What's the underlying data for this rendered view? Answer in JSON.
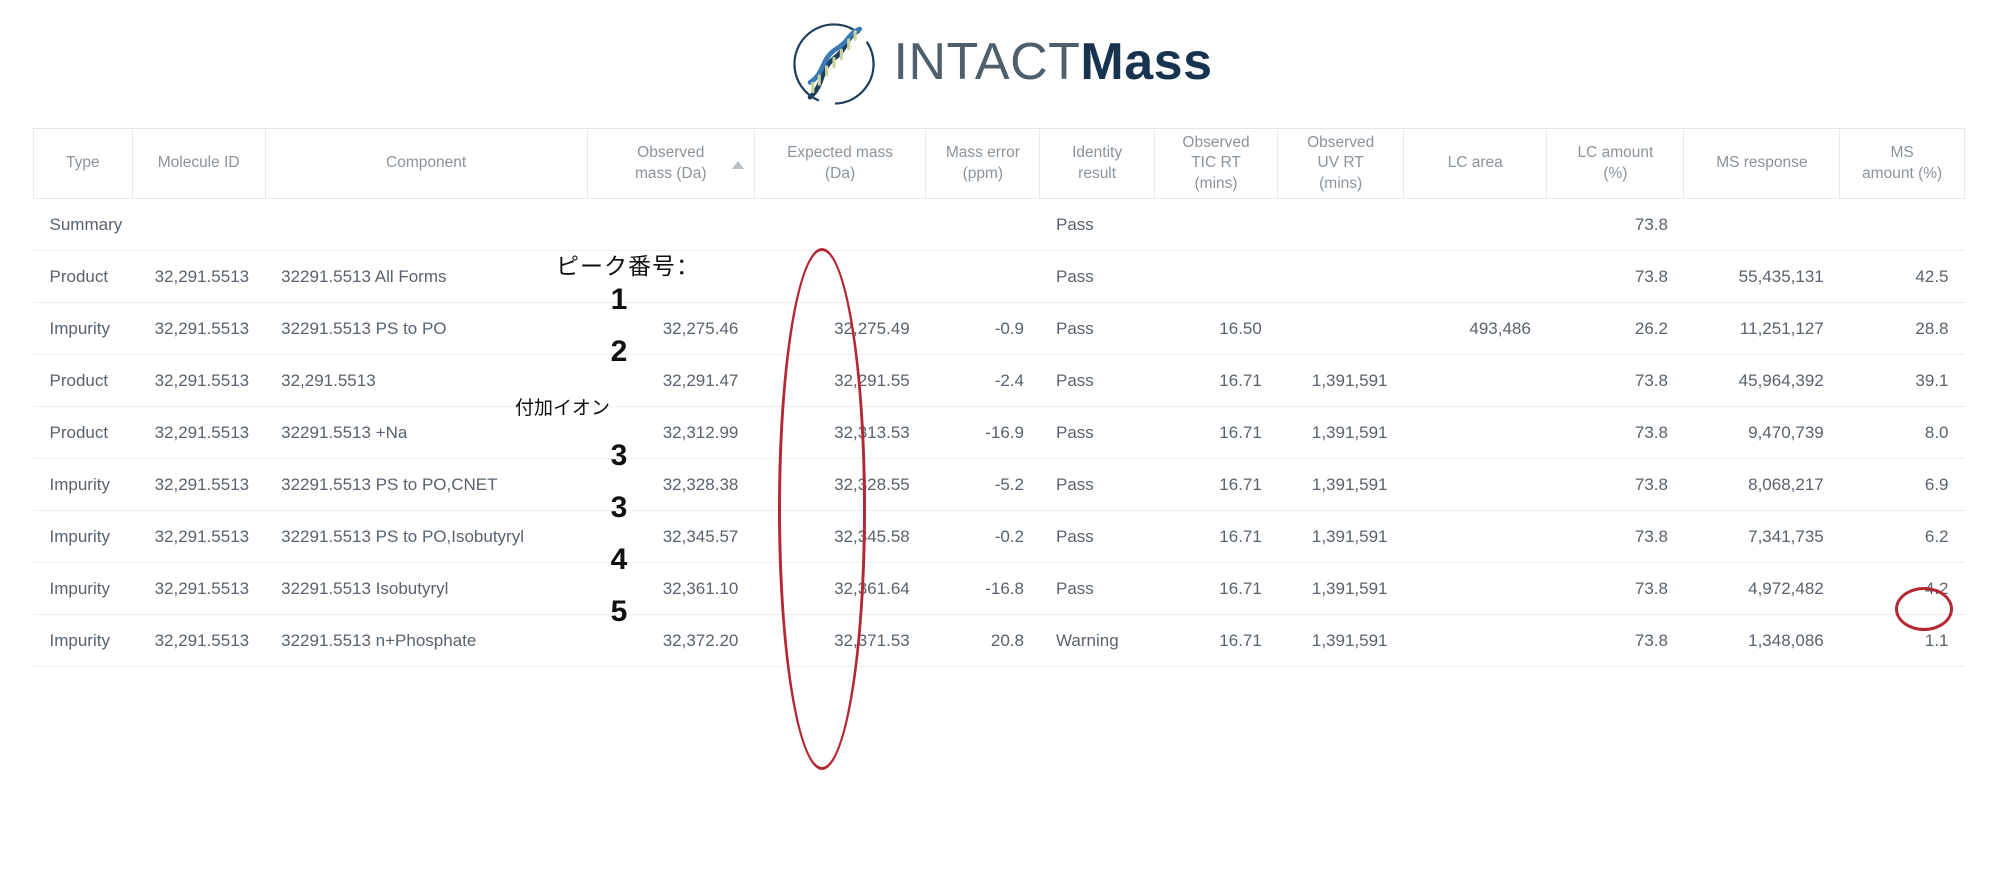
{
  "brand": {
    "light_text": "INTACT",
    "bold_text": "Mass",
    "logo_icon": "dna-helix-circle-icon",
    "accent_dark": "#17334f",
    "accent_blue": "#2f6ea8",
    "accent_green": "#c9d39a"
  },
  "table": {
    "sort": {
      "column": "Observed mass (Da)",
      "direction": "ascending",
      "icon": "sort-ascending-icon"
    },
    "columns": [
      {
        "label": "Type",
        "align": "left"
      },
      {
        "label": "Molecule ID",
        "align": "right"
      },
      {
        "label": "Component",
        "align": "left"
      },
      {
        "label": "Observed\nmass (Da)",
        "align": "right"
      },
      {
        "label": "Expected mass\n(Da)",
        "align": "right"
      },
      {
        "label": "Mass error\n(ppm)",
        "align": "right"
      },
      {
        "label": "Identity\nresult",
        "align": "left"
      },
      {
        "label": "Observed\nTIC RT\n(mins)",
        "align": "right"
      },
      {
        "label": "Observed\nUV RT\n(mins)",
        "align": "right"
      },
      {
        "label": "LC area",
        "align": "right"
      },
      {
        "label": "LC amount\n(%)",
        "align": "right"
      },
      {
        "label": "MS response",
        "align": "right"
      },
      {
        "label": "MS\namount (%)",
        "align": "right"
      }
    ],
    "column_labels": {
      "type": "Type",
      "molecule_id": "Molecule ID",
      "component": "Component",
      "observed_mass_l1": "Observed",
      "observed_mass_l2": "mass (Da)",
      "expected_mass_l1": "Expected mass",
      "expected_mass_l2": "(Da)",
      "mass_error_l1": "Mass error",
      "mass_error_l2": "(ppm)",
      "identity_l1": "Identity",
      "identity_l2": "result",
      "tic_rt_l1": "Observed",
      "tic_rt_l2": "TIC RT",
      "tic_rt_l3": "(mins)",
      "uv_rt_l1": "Observed",
      "uv_rt_l2": "UV RT",
      "uv_rt_l3": "(mins)",
      "lc_area": "LC area",
      "lc_amount_l1": "LC amount",
      "lc_amount_l2": "(%)",
      "ms_response": "MS response",
      "ms_amount_l1": "MS",
      "ms_amount_l2": "amount (%)"
    },
    "rows": [
      {
        "type": "Summary",
        "molecule_id": "",
        "component": "",
        "observed_mass": "",
        "expected_mass": "",
        "mass_error": "",
        "identity": "Pass",
        "tic_rt": "",
        "uv_rt": "",
        "lc_area": "",
        "lc_amount": "73.8",
        "ms_response": "",
        "ms_amount": ""
      },
      {
        "type": "Product",
        "molecule_id": "32,291.5513",
        "component": "32291.5513 All Forms",
        "observed_mass": "",
        "expected_mass": "",
        "mass_error": "",
        "identity": "Pass",
        "tic_rt": "",
        "uv_rt": "",
        "lc_area": "",
        "lc_amount": "73.8",
        "ms_response": "55,435,131",
        "ms_amount": "42.5"
      },
      {
        "type": "Impurity",
        "molecule_id": "32,291.5513",
        "component": "32291.5513 PS to PO",
        "observed_mass": "32,275.46",
        "expected_mass": "32,275.49",
        "mass_error": "-0.9",
        "identity": "Pass",
        "tic_rt": "16.50",
        "uv_rt": "",
        "lc_area": "493,486",
        "lc_amount": "26.2",
        "ms_response": "11,251,127",
        "ms_amount": "28.8"
      },
      {
        "type": "Product",
        "molecule_id": "32,291.5513",
        "component": "32,291.5513",
        "observed_mass": "32,291.47",
        "expected_mass": "32,291.55",
        "mass_error": "-2.4",
        "identity": "Pass",
        "tic_rt": "16.71",
        "uv_rt": "1,391,591",
        "lc_area": "",
        "lc_amount": "73.8",
        "ms_response": "45,964,392",
        "ms_amount": "39.1"
      },
      {
        "type": "Product",
        "molecule_id": "32,291.5513",
        "component": "32291.5513 +Na",
        "observed_mass": "32,312.99",
        "expected_mass": "32,313.53",
        "mass_error": "-16.9",
        "identity": "Pass",
        "tic_rt": "16.71",
        "uv_rt": "1,391,591",
        "lc_area": "",
        "lc_amount": "73.8",
        "ms_response": "9,470,739",
        "ms_amount": "8.0"
      },
      {
        "type": "Impurity",
        "molecule_id": "32,291.5513",
        "component": "32291.5513 PS to PO,CNET",
        "observed_mass": "32,328.38",
        "expected_mass": "32,328.55",
        "mass_error": "-5.2",
        "identity": "Pass",
        "tic_rt": "16.71",
        "uv_rt": "1,391,591",
        "lc_area": "",
        "lc_amount": "73.8",
        "ms_response": "8,068,217",
        "ms_amount": "6.9"
      },
      {
        "type": "Impurity",
        "molecule_id": "32,291.5513",
        "component": "32291.5513 PS to PO,Isobutyryl",
        "observed_mass": "32,345.57",
        "expected_mass": "32,345.58",
        "mass_error": "-0.2",
        "identity": "Pass",
        "tic_rt": "16.71",
        "uv_rt": "1,391,591",
        "lc_area": "",
        "lc_amount": "73.8",
        "ms_response": "7,341,735",
        "ms_amount": "6.2"
      },
      {
        "type": "Impurity",
        "molecule_id": "32,291.5513",
        "component": "32291.5513 Isobutyryl",
        "observed_mass": "32,361.10",
        "expected_mass": "32,361.64",
        "mass_error": "-16.8",
        "identity": "Pass",
        "tic_rt": "16.71",
        "uv_rt": "1,391,591",
        "lc_area": "",
        "lc_amount": "73.8",
        "ms_response": "4,972,482",
        "ms_amount": "4.2"
      },
      {
        "type": "Impurity",
        "molecule_id": "32,291.5513",
        "component": "32291.5513 n+Phosphate",
        "observed_mass": "32,372.20",
        "expected_mass": "32,371.53",
        "mass_error": "20.8",
        "identity": "Warning",
        "tic_rt": "16.71",
        "uv_rt": "1,391,591",
        "lc_area": "",
        "lc_amount": "73.8",
        "ms_response": "1,348,086",
        "ms_amount": "1.1"
      }
    ]
  },
  "annotations": {
    "color": "#b42834",
    "peak_number_label": "ピーク番号：",
    "adduct_label": "付加イオン",
    "peak_digits": [
      "1",
      "2",
      "3",
      "3",
      "4",
      "5"
    ],
    "peak_digit_1": "1",
    "peak_digit_2": "2",
    "peak_digit_3a": "3",
    "peak_digit_3b": "3",
    "peak_digit_4": "4",
    "peak_digit_5": "5"
  }
}
